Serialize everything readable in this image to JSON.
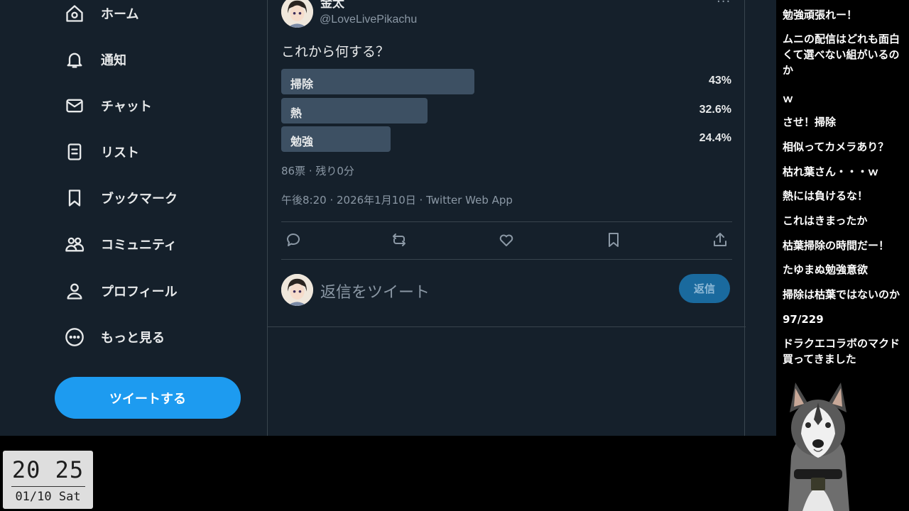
{
  "sidebar": {
    "items": [
      {
        "label": "ホーム",
        "icon": "home-icon"
      },
      {
        "label": "通知",
        "icon": "bell-icon"
      },
      {
        "label": "チャット",
        "icon": "mail-icon"
      },
      {
        "label": "リスト",
        "icon": "list-icon"
      },
      {
        "label": "ブックマーク",
        "icon": "bookmark-icon"
      },
      {
        "label": "コミュニティ",
        "icon": "communities-icon"
      },
      {
        "label": "プロフィール",
        "icon": "profile-icon"
      },
      {
        "label": "もっと見る",
        "icon": "more-circle-icon"
      }
    ],
    "tweet_button": "ツイートする"
  },
  "tweet": {
    "author_name": "金太",
    "author_handle": "@LoveLivePikachu",
    "more": "···",
    "text": "これから何する？",
    "poll": {
      "options": [
        {
          "label": "掃除",
          "percent": "43%",
          "fraction": 0.43
        },
        {
          "label": "熱",
          "percent": "32.6%",
          "fraction": 0.326
        },
        {
          "label": "勉強",
          "percent": "24.4%",
          "fraction": 0.244
        }
      ],
      "meta": "86票 · 残り0分"
    },
    "timestamp": "午後8:20 · 2026年1月10日 · Twitter Web App",
    "actions": [
      "reply-icon",
      "retweet-icon",
      "like-icon",
      "bookmark-icon",
      "share-icon"
    ]
  },
  "reply": {
    "placeholder": "返信をツイート",
    "button": "返信"
  },
  "clock": {
    "time": "20 25",
    "date": "01/10 Sat"
  },
  "chat": {
    "messages": [
      "勉強頑張れー！",
      "ムニの配信はどれも面白くて選べない組がいるのか",
      "ｗ",
      "させ！掃除",
      "相似ってカメラあり？",
      "枯れ葉さん・・・ｗ",
      "熱には負けるな！",
      "これはきまったか",
      "枯葉掃除の時間だー！",
      "たゆまぬ勉強意欲",
      "掃除は枯葉ではないのか",
      "97/229",
      "ドラクエコラボのマクド買ってきました"
    ]
  },
  "colors": {
    "background": "#15202b",
    "accent": "#1d9bf0",
    "poll_bar": "#3d5063",
    "muted_text": "#8b98a5"
  }
}
